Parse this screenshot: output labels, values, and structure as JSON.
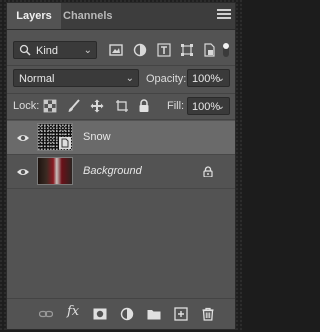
{
  "tabs": [
    {
      "label": "Layers"
    },
    {
      "label": "Channels"
    }
  ],
  "filter": {
    "kind_label": "Kind"
  },
  "blend": {
    "mode": "Normal",
    "opacity_label": "Opacity:",
    "opacity_value": "100%"
  },
  "lock": {
    "label": "Lock:",
    "fill_label": "Fill:",
    "fill_value": "100%"
  },
  "layers": [
    {
      "name": "Snow",
      "selected": true
    },
    {
      "name": "Background",
      "locked": true
    }
  ],
  "colors": {
    "panel": "#535353",
    "selected": "#6a6a6a",
    "tabbar": "#3d3d3d"
  }
}
